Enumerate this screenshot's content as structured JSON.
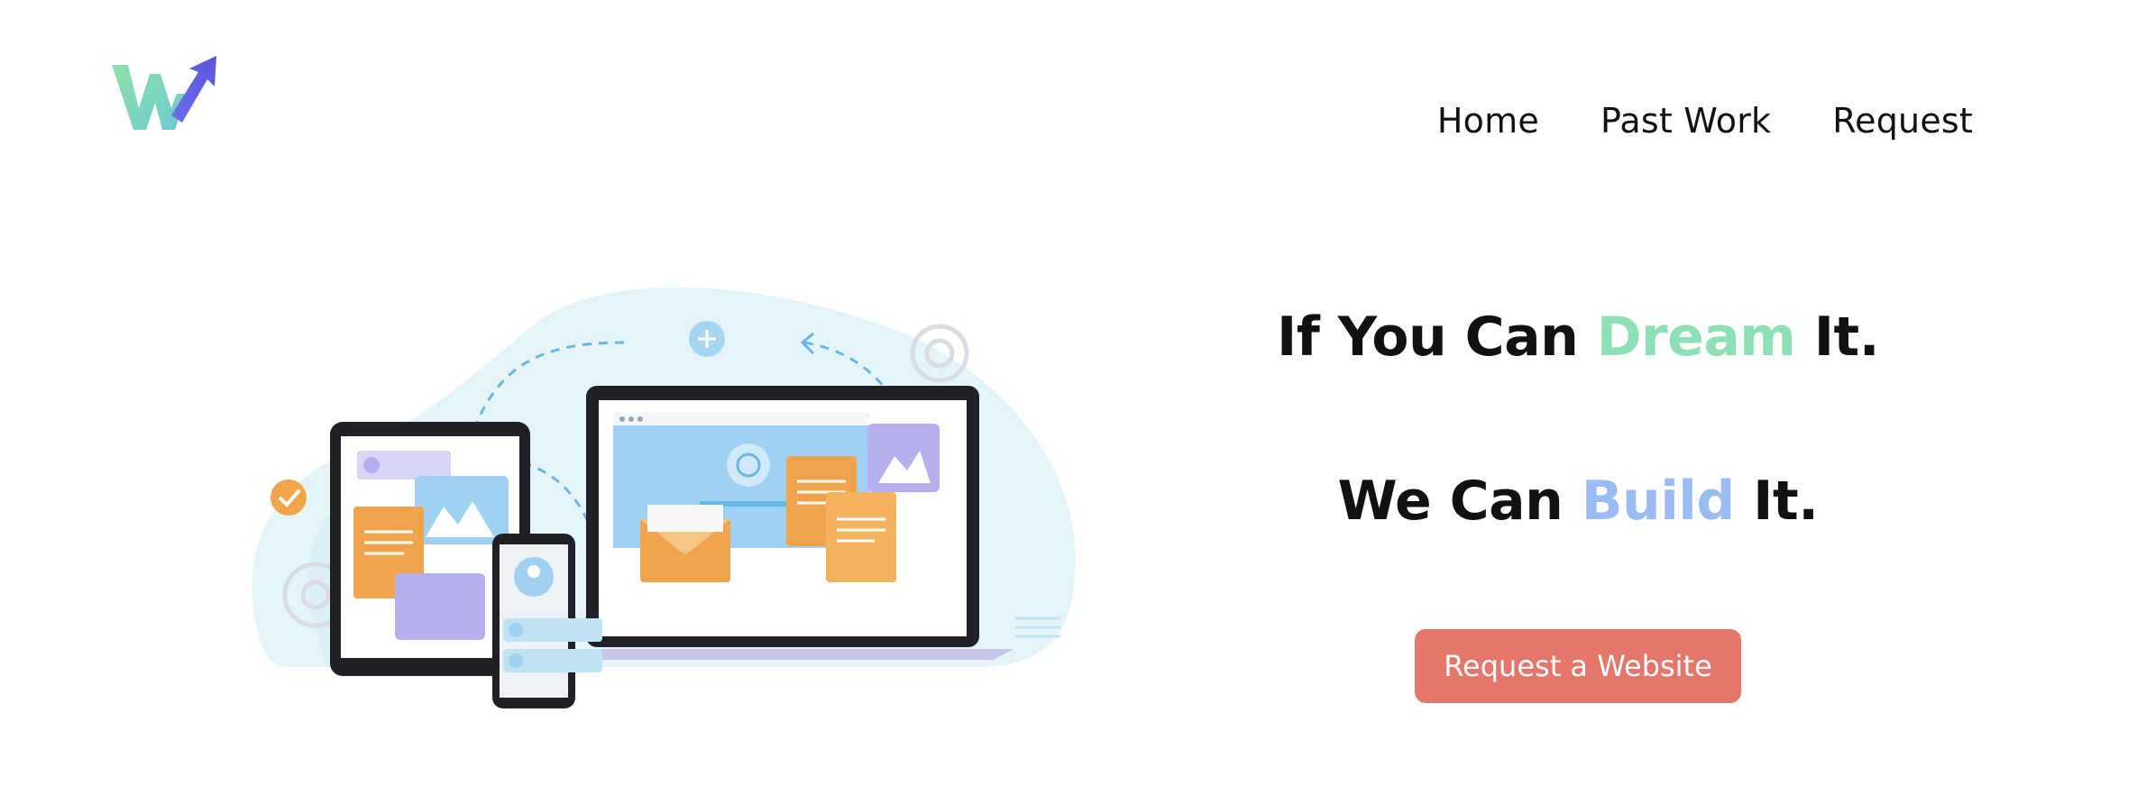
{
  "header": {
    "logo_icon": "w-arrow-logo",
    "nav": [
      {
        "label": "Home"
      },
      {
        "label": "Past Work"
      },
      {
        "label": "Request"
      }
    ]
  },
  "hero": {
    "line1": {
      "prefix": "If You Can ",
      "accent": "Dream",
      "suffix": " It."
    },
    "line2": {
      "prefix": "We Can ",
      "accent": "Build",
      "suffix": " It."
    },
    "cta_label": "Request a Website",
    "illustration": "devices-sync-illustration"
  },
  "colors": {
    "dream_accent": "#8de0b6",
    "build_accent": "#9bbcf2",
    "cta_background": "#e4766c",
    "text": "#111111"
  }
}
